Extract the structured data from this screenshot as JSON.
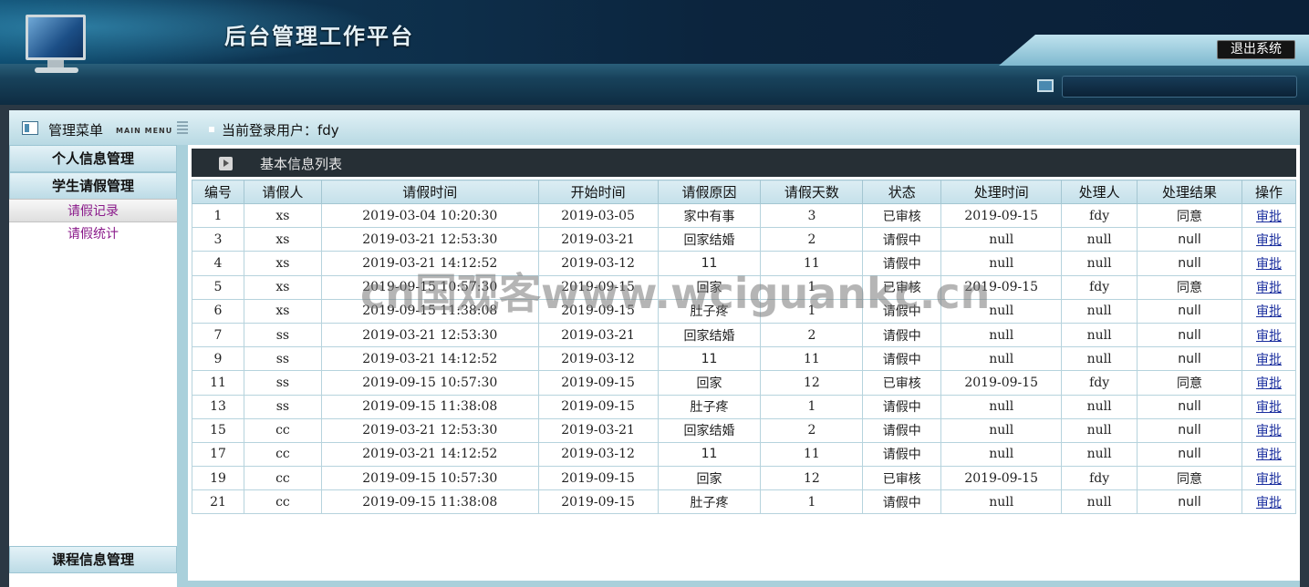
{
  "app": {
    "title": "后台管理工作平台",
    "logout_label": "退出系统"
  },
  "menu": {
    "title": "管理菜单",
    "subtitle": "MAIN MENU"
  },
  "user": {
    "label": "当前登录用户：fdy"
  },
  "sidebar": {
    "sections": [
      {
        "label": "个人信息管理"
      },
      {
        "label": "学生请假管理"
      }
    ],
    "items": [
      {
        "label": "请假记录"
      },
      {
        "label": "请假统计"
      }
    ],
    "bottom_section": {
      "label": "课程信息管理"
    }
  },
  "list": {
    "title": "基本信息列表"
  },
  "table": {
    "headers": [
      "编号",
      "请假人",
      "请假时间",
      "开始时间",
      "请假原因",
      "请假天数",
      "状态",
      "处理时间",
      "处理人",
      "处理结果",
      "操作"
    ],
    "rows": [
      [
        "1",
        "xs",
        "2019-03-04 10:20:30",
        "2019-03-05",
        "家中有事",
        "3",
        "已审核",
        "2019-09-15",
        "fdy",
        "同意",
        "审批"
      ],
      [
        "3",
        "xs",
        "2019-03-21 12:53:30",
        "2019-03-21",
        "回家结婚",
        "2",
        "请假中",
        "null",
        "null",
        "null",
        "审批"
      ],
      [
        "4",
        "xs",
        "2019-03-21 14:12:52",
        "2019-03-12",
        "11",
        "11",
        "请假中",
        "null",
        "null",
        "null",
        "审批"
      ],
      [
        "5",
        "xs",
        "2019-09-15 10:57:30",
        "2019-09-15",
        "回家",
        "1",
        "已审核",
        "2019-09-15",
        "fdy",
        "同意",
        "审批"
      ],
      [
        "6",
        "xs",
        "2019-09-15 11:38:08",
        "2019-09-15",
        "肚子疼",
        "1",
        "请假中",
        "null",
        "null",
        "null",
        "审批"
      ],
      [
        "7",
        "ss",
        "2019-03-21 12:53:30",
        "2019-03-21",
        "回家结婚",
        "2",
        "请假中",
        "null",
        "null",
        "null",
        "审批"
      ],
      [
        "9",
        "ss",
        "2019-03-21 14:12:52",
        "2019-03-12",
        "11",
        "11",
        "请假中",
        "null",
        "null",
        "null",
        "审批"
      ],
      [
        "11",
        "ss",
        "2019-09-15 10:57:30",
        "2019-09-15",
        "回家",
        "12",
        "已审核",
        "2019-09-15",
        "fdy",
        "同意",
        "审批"
      ],
      [
        "13",
        "ss",
        "2019-09-15 11:38:08",
        "2019-09-15",
        "肚子疼",
        "1",
        "请假中",
        "null",
        "null",
        "null",
        "审批"
      ],
      [
        "15",
        "cc",
        "2019-03-21 12:53:30",
        "2019-03-21",
        "回家结婚",
        "2",
        "请假中",
        "null",
        "null",
        "null",
        "审批"
      ],
      [
        "17",
        "cc",
        "2019-03-21 14:12:52",
        "2019-03-12",
        "11",
        "11",
        "请假中",
        "null",
        "null",
        "null",
        "审批"
      ],
      [
        "19",
        "cc",
        "2019-09-15 10:57:30",
        "2019-09-15",
        "回家",
        "12",
        "已审核",
        "2019-09-15",
        "fdy",
        "同意",
        "审批"
      ],
      [
        "21",
        "cc",
        "2019-09-15 11:38:08",
        "2019-09-15",
        "肚子疼",
        "1",
        "请假中",
        "null",
        "null",
        "null",
        "审批"
      ]
    ]
  },
  "watermark": "cn国观客www.wciguankc.cn"
}
